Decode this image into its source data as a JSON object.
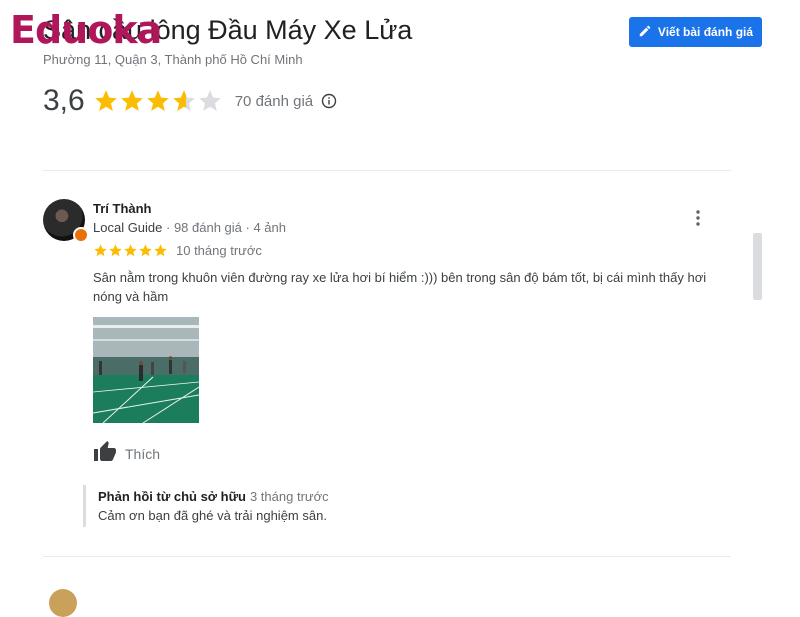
{
  "watermark": "Eduoka",
  "place": {
    "title": "Sân cầu lông Đầu Máy Xe Lửa",
    "address": "Phường 11, Quận 3, Thành phố Hồ Chí Minh",
    "rating": "3,6",
    "stars_value": 3.6,
    "review_count": "70 đánh giá",
    "write_review_label": "Viết bài đánh giá"
  },
  "review": {
    "author": "Trí Thành",
    "meta_guide": "Local Guide",
    "meta_rest": " · 98 đánh giá · 4 ảnh",
    "stars": 5,
    "date": "10 tháng trước",
    "text": "Sân nằm trong khuôn viên đường ray xe lửa hơi bí hiểm :))) bên trong sân độ bám tốt, bị cái mình thấy hơi nóng và hầm",
    "like_label": "Thích",
    "owner_reply": {
      "title": "Phản hồi từ chủ sở hữu",
      "date": "3 tháng trước",
      "text": "Cảm ơn bạn đã ghé và trải nghiệm sân."
    }
  },
  "colors": {
    "accent": "#1a73e8",
    "star": "#fbbc04",
    "star_empty": "#dadce0",
    "watermark": "#b0175a"
  },
  "icons": [
    "pencil-icon",
    "info-icon",
    "more-vert-icon",
    "thumbs-up-icon",
    "star-icon"
  ]
}
